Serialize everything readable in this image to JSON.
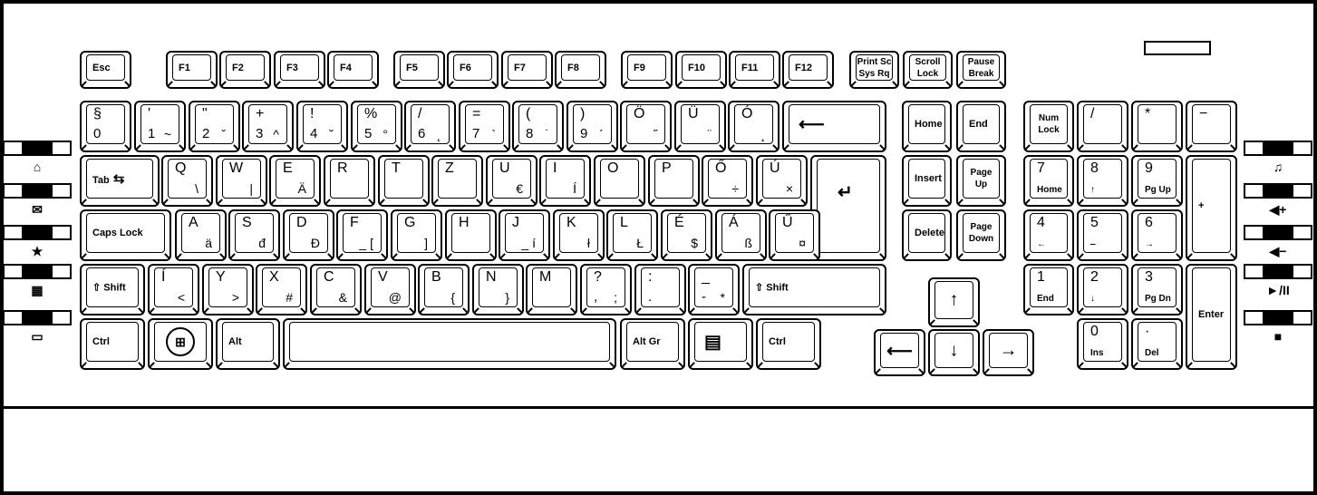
{
  "keys": [
    {
      "name": "esc",
      "label": "Esc"
    },
    {
      "name": "f1",
      "label": "F1"
    },
    {
      "name": "f2",
      "label": "F2"
    },
    {
      "name": "f3",
      "label": "F3"
    },
    {
      "name": "f4",
      "label": "F4"
    },
    {
      "name": "f5",
      "label": "F5"
    },
    {
      "name": "f6",
      "label": "F6"
    },
    {
      "name": "f7",
      "label": "F7"
    },
    {
      "name": "f8",
      "label": "F8"
    },
    {
      "name": "f9",
      "label": "F9"
    },
    {
      "name": "f10",
      "label": "F10"
    },
    {
      "name": "f11",
      "label": "F11"
    },
    {
      "name": "f12",
      "label": "F12"
    },
    {
      "name": "print-screen",
      "line1": "Print Sc",
      "line2": "Sys Rq"
    },
    {
      "name": "scroll-lock",
      "line1": "Scroll",
      "line2": "Lock"
    },
    {
      "name": "pause",
      "line1": "Pause",
      "line2": "Break"
    },
    {
      "name": "0",
      "top": "§",
      "bottom": "0"
    },
    {
      "name": "1",
      "top": "'",
      "bottom": "1",
      "altgr": "~"
    },
    {
      "name": "2",
      "top": "\"",
      "bottom": "2",
      "altgr": "ˇ"
    },
    {
      "name": "3",
      "top": "+",
      "bottom": "3",
      "altgr": "^"
    },
    {
      "name": "4",
      "top": "!",
      "bottom": "4",
      "altgr": "˘"
    },
    {
      "name": "5",
      "top": "%",
      "bottom": "5",
      "altgr": "°"
    },
    {
      "name": "6",
      "top": "/",
      "bottom": "6",
      "altgr": "˛"
    },
    {
      "name": "7",
      "top": "=",
      "bottom": "7",
      "altgr": "`"
    },
    {
      "name": "8",
      "top": "(",
      "bottom": "8",
      "altgr": "˙"
    },
    {
      "name": "9",
      "top": ")",
      "bottom": "9",
      "altgr": "´"
    },
    {
      "name": "o-umlaut",
      "top": "Ö",
      "altgr": "˝"
    },
    {
      "name": "u-umlaut",
      "top": "Ü",
      "altgr": "¨"
    },
    {
      "name": "o-acute",
      "top": "Ó",
      "altgr": "¸"
    },
    {
      "name": "backspace",
      "icon": "arrow-left"
    },
    {
      "name": "tab",
      "label": "Tab",
      "icon": "tab-arrows"
    },
    {
      "name": "q",
      "top": "Q",
      "altgr": "\\"
    },
    {
      "name": "w",
      "top": "W",
      "altgr": "|"
    },
    {
      "name": "e",
      "top": "E",
      "altgr": "Ä"
    },
    {
      "name": "r",
      "top": "R"
    },
    {
      "name": "t",
      "top": "T"
    },
    {
      "name": "z",
      "top": "Z"
    },
    {
      "name": "u",
      "top": "U",
      "altgr": "€"
    },
    {
      "name": "i",
      "top": "I",
      "altgr": "Í"
    },
    {
      "name": "o",
      "top": "O"
    },
    {
      "name": "p",
      "top": "P"
    },
    {
      "name": "o-double-acute",
      "top": "Ő",
      "altgr": "÷"
    },
    {
      "name": "u-acute",
      "top": "Ú",
      "altgr": "×"
    },
    {
      "name": "enter",
      "icon": "enter-arrow"
    },
    {
      "name": "caps-lock",
      "label": "Caps Lock"
    },
    {
      "name": "a",
      "top": "A",
      "altgr": "ä"
    },
    {
      "name": "s",
      "top": "S",
      "altgr": "đ"
    },
    {
      "name": "d",
      "top": "D",
      "altgr": "Đ"
    },
    {
      "name": "f",
      "top": "F",
      "altgr": "_ ["
    },
    {
      "name": "g",
      "top": "G",
      "altgr": "]"
    },
    {
      "name": "h",
      "top": "H"
    },
    {
      "name": "j",
      "top": "J",
      "altgr": "_ í"
    },
    {
      "name": "k",
      "top": "K",
      "altgr": "ł"
    },
    {
      "name": "l",
      "top": "L",
      "altgr": "Ł"
    },
    {
      "name": "e-acute",
      "top": "É",
      "altgr": "$"
    },
    {
      "name": "a-acute",
      "top": "Á",
      "altgr": "ß"
    },
    {
      "name": "u-double-acute",
      "top": "Ű",
      "altgr": "¤"
    },
    {
      "name": "left-shift",
      "label": "Shift",
      "icon": "shift-arrow"
    },
    {
      "name": "i-acute",
      "top": "Í",
      "altgr": "<"
    },
    {
      "name": "y",
      "top": "Y",
      "altgr": ">"
    },
    {
      "name": "x",
      "top": "X",
      "altgr": "#"
    },
    {
      "name": "c",
      "top": "C",
      "altgr": "&"
    },
    {
      "name": "v",
      "top": "V",
      "altgr": "@"
    },
    {
      "name": "b",
      "top": "B",
      "altgr": "{"
    },
    {
      "name": "n",
      "top": "N",
      "altgr": "}"
    },
    {
      "name": "m",
      "top": "M"
    },
    {
      "name": "comma",
      "top": "?",
      "bottom": ",",
      "altgr": ";"
    },
    {
      "name": "period",
      "top": ":",
      "bottom": "."
    },
    {
      "name": "minus",
      "top": "_",
      "bottom": "-",
      "altgr": "*"
    },
    {
      "name": "right-shift",
      "label": "Shift",
      "icon": "shift-arrow"
    },
    {
      "name": "left-ctrl",
      "label": "Ctrl"
    },
    {
      "name": "windows",
      "icon": "windows-logo"
    },
    {
      "name": "alt",
      "label": "Alt"
    },
    {
      "name": "space"
    },
    {
      "name": "alt-gr",
      "label": "Alt Gr"
    },
    {
      "name": "menu",
      "icon": "menu"
    },
    {
      "name": "right-ctrl",
      "label": "Ctrl"
    },
    {
      "name": "home",
      "label": "Home"
    },
    {
      "name": "end",
      "label": "End"
    },
    {
      "name": "insert",
      "label": "Insert"
    },
    {
      "name": "page-up",
      "line1": "Page",
      "line2": "Up"
    },
    {
      "name": "delete",
      "label": "Delete"
    },
    {
      "name": "page-down",
      "line1": "Page",
      "line2": "Down"
    },
    {
      "name": "arrow-up",
      "icon": "arrow-up"
    },
    {
      "name": "arrow-left",
      "icon": "arrow-left"
    },
    {
      "name": "arrow-down",
      "icon": "arrow-down"
    },
    {
      "name": "arrow-right",
      "icon": "arrow-right"
    },
    {
      "name": "num-lock",
      "line1": "Num",
      "line2": "Lock"
    },
    {
      "name": "num-divide",
      "top": "/"
    },
    {
      "name": "num-multiply",
      "top": "*"
    },
    {
      "name": "num-minus",
      "top": "−"
    },
    {
      "name": "num-7",
      "top": "7",
      "sub": "Home"
    },
    {
      "name": "num-8",
      "top": "8",
      "sub": "↑"
    },
    {
      "name": "num-9",
      "top": "9",
      "sub": "Pg Up"
    },
    {
      "name": "num-plus",
      "label": "+"
    },
    {
      "name": "num-4",
      "top": "4",
      "sub": "←"
    },
    {
      "name": "num-5",
      "top": "5",
      "sub": "‒"
    },
    {
      "name": "num-6",
      "top": "6",
      "sub": "→"
    },
    {
      "name": "num-1",
      "top": "1",
      "sub": "End"
    },
    {
      "name": "num-2",
      "top": "2",
      "sub": "↓"
    },
    {
      "name": "num-3",
      "top": "3",
      "sub": "Pg Dn"
    },
    {
      "name": "num-enter",
      "label": "Enter"
    },
    {
      "name": "num-0",
      "top": "0",
      "sub": "Ins"
    },
    {
      "name": "num-decimal",
      "top": "·",
      "sub": "Del"
    }
  ],
  "side_buttons": {
    "left": [
      "home-icon",
      "mail-icon",
      "favorites-star-icon",
      "calculator-icon",
      "sleep-icon"
    ],
    "right": [
      "music-icon",
      "volume-up-icon",
      "volume-down-icon",
      "play-pause-icon",
      "stop-icon"
    ]
  }
}
